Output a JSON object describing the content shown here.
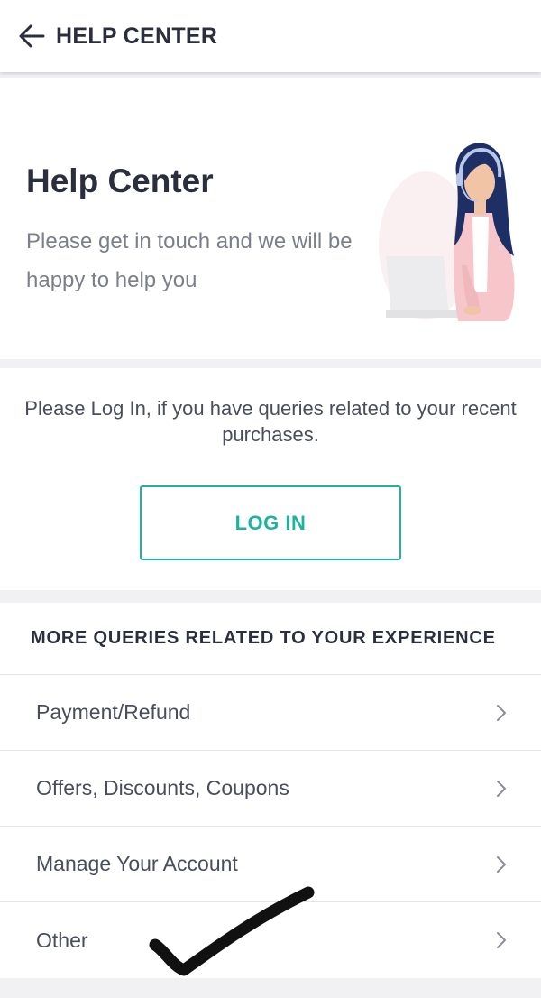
{
  "header": {
    "title": "HELP CENTER",
    "back_icon": "arrow-left-icon"
  },
  "hero": {
    "title": "Help Center",
    "subtitle": "Please get in touch and we will be happy to help you",
    "illustration": "support-agent-illustration"
  },
  "login": {
    "prompt": "Please Log In, if you have queries related to your recent purchases.",
    "button_label": "LOG IN",
    "accent_color": "#1fb2a0"
  },
  "queries": {
    "heading": "MORE QUERIES RELATED TO YOUR EXPERIENCE",
    "items": [
      {
        "label": "Payment/Refund",
        "icon": "chevron-right-icon"
      },
      {
        "label": "Offers, Discounts, Coupons",
        "icon": "chevron-right-icon"
      },
      {
        "label": "Manage Your Account",
        "icon": "chevron-right-icon"
      },
      {
        "label": "Other",
        "icon": "chevron-right-icon"
      }
    ]
  },
  "annotation": {
    "mark": "handwritten-checkmark",
    "target": "Other"
  }
}
